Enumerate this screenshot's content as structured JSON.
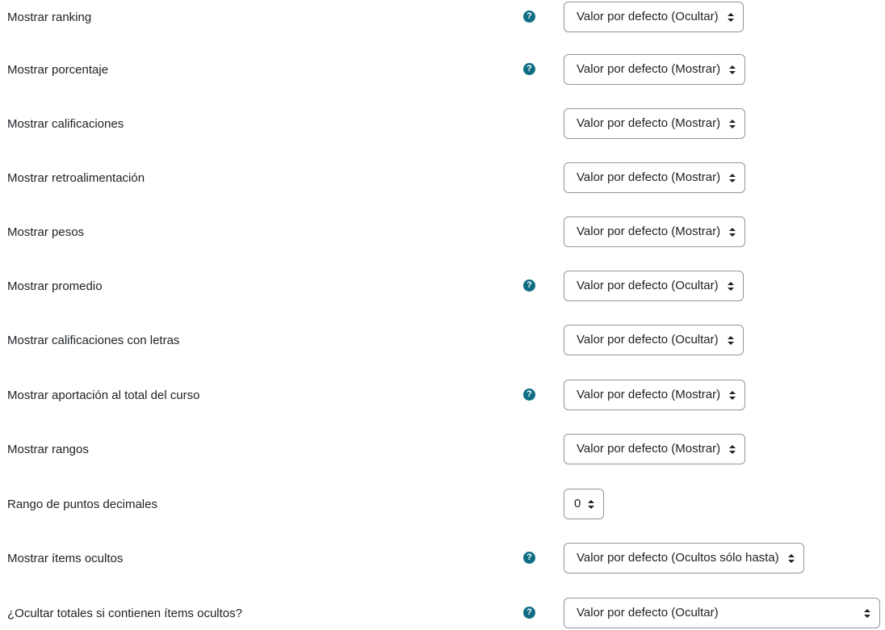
{
  "help_icon_glyph": "?",
  "settings": [
    {
      "label": "Mostrar ranking",
      "help": true,
      "value": "Valor por defecto (Ocultar)"
    },
    {
      "label": "Mostrar porcentaje",
      "help": true,
      "value": "Valor por defecto (Mostrar)"
    },
    {
      "label": "Mostrar calificaciones",
      "help": false,
      "value": "Valor por defecto (Mostrar)"
    },
    {
      "label": "Mostrar retroalimentación",
      "help": false,
      "value": "Valor por defecto (Mostrar)"
    },
    {
      "label": "Mostrar pesos",
      "help": false,
      "value": "Valor por defecto (Mostrar)"
    },
    {
      "label": "Mostrar promedio",
      "help": true,
      "value": "Valor por defecto (Ocultar)"
    },
    {
      "label": "Mostrar calificaciones con letras",
      "help": false,
      "value": "Valor por defecto (Ocultar)"
    },
    {
      "label": "Mostrar aportación al total del curso",
      "help": true,
      "value": "Valor por defecto (Mostrar)"
    },
    {
      "label": "Mostrar rangos",
      "help": false,
      "value": "Valor por defecto (Mostrar)"
    },
    {
      "label": "Rango de puntos decimales",
      "help": false,
      "value": "0"
    },
    {
      "label": "Mostrar ítems ocultos",
      "help": true,
      "value": "Valor por defecto (Ocultos sólo hasta)"
    },
    {
      "label": "¿Ocultar totales si contienen ítems ocultos?",
      "help": true,
      "value": "Valor por defecto (Ocultar)"
    }
  ],
  "colors": {
    "help_icon": "#0f6e84",
    "text": "#1d2125",
    "select_border": "#8f959e"
  }
}
